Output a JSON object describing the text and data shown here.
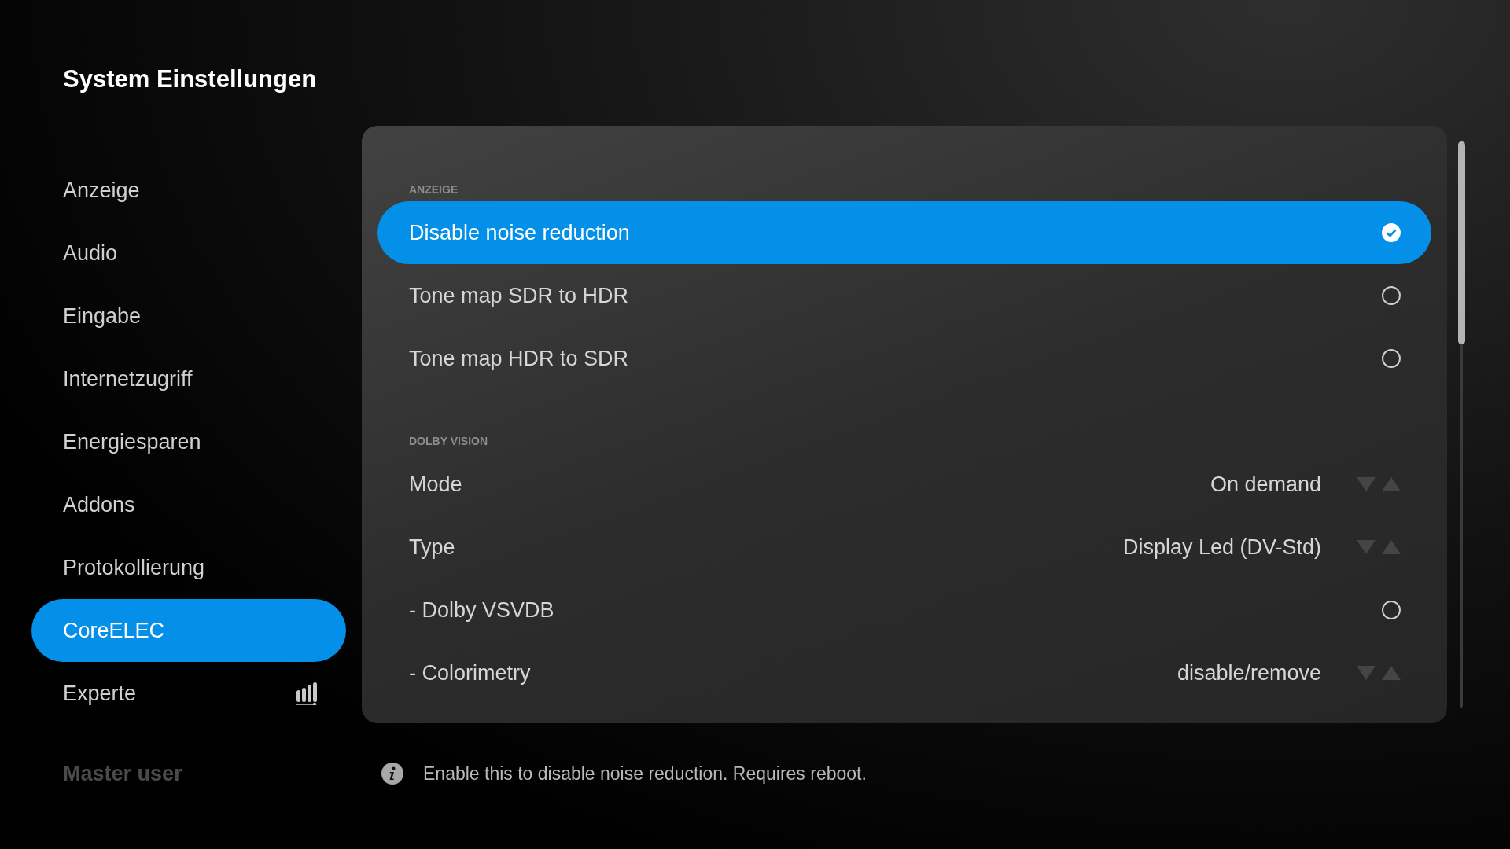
{
  "title": "System Einstellungen",
  "sidebar": {
    "items": [
      {
        "label": "Anzeige",
        "selected": false
      },
      {
        "label": "Audio",
        "selected": false
      },
      {
        "label": "Eingabe",
        "selected": false
      },
      {
        "label": "Internetzugriff",
        "selected": false
      },
      {
        "label": "Energiesparen",
        "selected": false
      },
      {
        "label": "Addons",
        "selected": false
      },
      {
        "label": "Protokollierung",
        "selected": false
      },
      {
        "label": "CoreELEC",
        "selected": true
      },
      {
        "label": "Experte",
        "selected": false,
        "level_icon": true
      }
    ]
  },
  "user": "Master user",
  "sections": [
    {
      "heading": "ANZEIGE",
      "rows": [
        {
          "kind": "toggle",
          "label": "Disable noise reduction",
          "checked": true,
          "selected": true
        },
        {
          "kind": "toggle",
          "label": "Tone map SDR to HDR",
          "checked": false,
          "selected": false
        },
        {
          "kind": "toggle",
          "label": "Tone map HDR to SDR",
          "checked": false,
          "selected": false
        }
      ]
    },
    {
      "heading": "DOLBY VISION",
      "rows": [
        {
          "kind": "spinner",
          "label": "Mode",
          "value": "On demand",
          "selected": false
        },
        {
          "kind": "spinner",
          "label": "Type",
          "value": "Display Led (DV-Std)",
          "selected": false
        },
        {
          "kind": "toggle",
          "label": "- Dolby VSVDB",
          "checked": false,
          "selected": false
        },
        {
          "kind": "spinner",
          "label": "- Colorimetry",
          "value": "disable/remove",
          "selected": false
        }
      ]
    }
  ],
  "info": "Enable this to disable noise reduction. Requires reboot."
}
